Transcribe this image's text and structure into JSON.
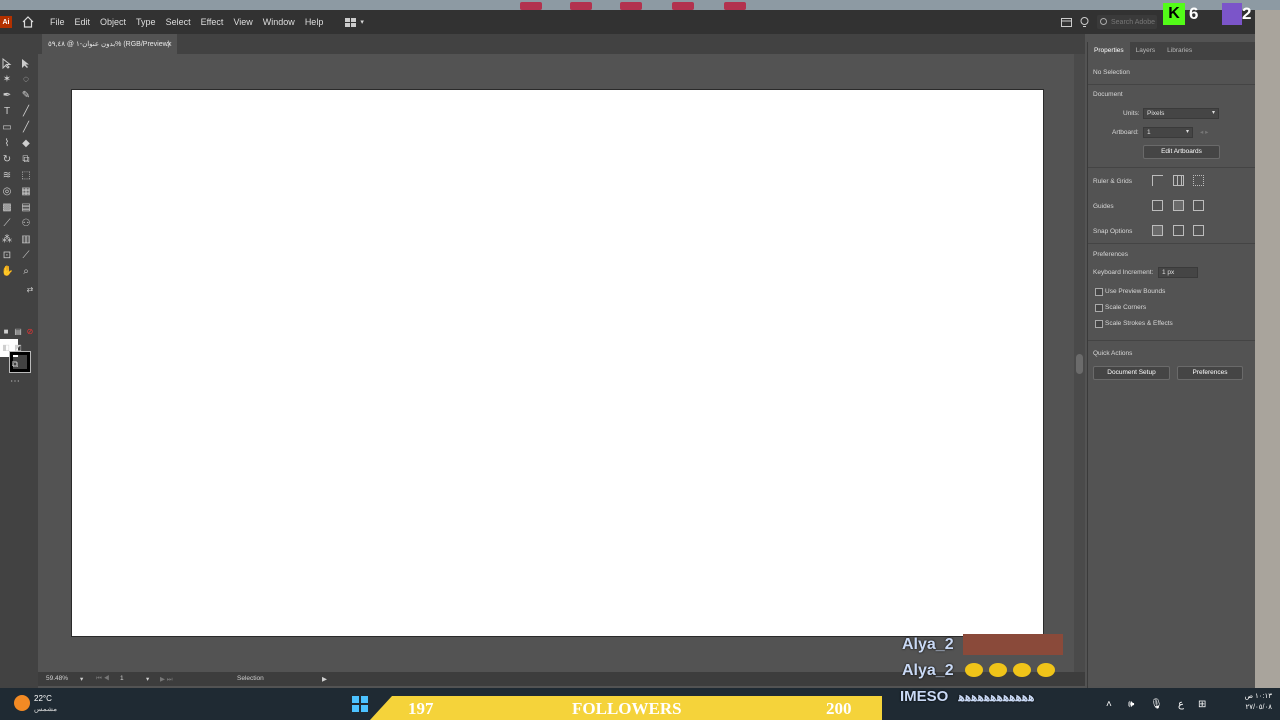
{
  "app": {
    "logo": "Ai"
  },
  "menu": [
    "File",
    "Edit",
    "Object",
    "Type",
    "Select",
    "Effect",
    "View",
    "Window",
    "Help"
  ],
  "search": {
    "placeholder": "Search Adobe"
  },
  "stream": {
    "kick_count": "6",
    "twitch_count": "2"
  },
  "document": {
    "tab_title": "بدون عنوان-١ @ ٥٩,٤٨% (RGB/Preview)",
    "close": "×"
  },
  "status": {
    "zoom": "59.48%",
    "artboard": "1",
    "tool": "Selection"
  },
  "panel": {
    "tabs": [
      "Properties",
      "Layers",
      "Libraries"
    ],
    "selection": "No Selection",
    "document_heading": "Document",
    "units_label": "Units:",
    "units_value": "Pixels",
    "artboard_label": "Artboard:",
    "artboard_value": "1",
    "edit_artboards": "Edit Artboards",
    "ruler_grids": "Ruler & Grids",
    "guides": "Guides",
    "snap_options": "Snap Options",
    "preferences_heading": "Preferences",
    "keyboard_increment_label": "Keyboard Increment:",
    "keyboard_increment_value": "1 px",
    "use_preview_bounds": "Use Preview Bounds",
    "scale_corners": "Scale Corners",
    "scale_strokes": "Scale Strokes & Effects",
    "quick_actions": "Quick Actions",
    "document_setup": "Document Setup",
    "preferences_button": "Preferences"
  },
  "overlay": {
    "name1": "Alya_2",
    "name2": "Alya_2",
    "followers_current": "197",
    "followers_label": "FOLLOWERS",
    "followers_goal": "200",
    "imeso": "IMESO",
    "imeso_tail": "ﻫﻫﻫﻫﻫﻫﻫﻫﻫﻫﻫﻫ"
  },
  "taskbar": {
    "temp": "22°C",
    "weather": "مشمس",
    "time": "١٠:١٣ ص",
    "date": "٢٧/٠٥/٠٨",
    "lang": "ع"
  },
  "colors": {
    "accent_yellow": "#f5d33a",
    "ai_orange": "#b33100",
    "kick_green": "#53fc18"
  }
}
